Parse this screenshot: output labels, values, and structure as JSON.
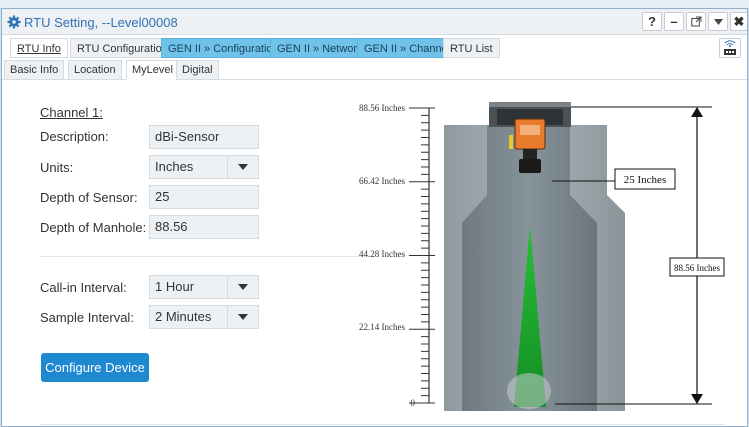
{
  "window": {
    "title": "RTU Setting, --Level00008"
  },
  "titlebar_buttons": {
    "help": "?",
    "minimize": "–",
    "close": "✖"
  },
  "tabs_primary": [
    {
      "label": "RTU Info",
      "active": true
    },
    {
      "label": "RTU Configuration"
    },
    {
      "label": "GEN II » Configuration"
    },
    {
      "label": "GEN II » Network"
    },
    {
      "label": "GEN II » Channel"
    },
    {
      "label": "RTU List"
    }
  ],
  "tabs_secondary": [
    {
      "label": "Basic Info"
    },
    {
      "label": "Location"
    },
    {
      "label": "MyLevel",
      "active": true
    },
    {
      "label": "Digital"
    }
  ],
  "form": {
    "channel_heading": "Channel 1:",
    "description_label": "Description:",
    "description_value": "dBi-Sensor",
    "units_label": "Units:",
    "units_value": "Inches",
    "sensor_depth_label": "Depth of Sensor:",
    "sensor_depth_value": "25",
    "manhole_depth_label": "Depth of Manhole:",
    "manhole_depth_value": "88.56",
    "callin_label": "Call-in Interval:",
    "callin_value": "1 Hour",
    "sample_label": "Sample Interval:",
    "sample_value": "2 Minutes",
    "configure_button": "Configure Device"
  },
  "diagram": {
    "scale_labels": [
      "88.56 Inches",
      "66.42 Inches",
      "44.28 Inches",
      "22.14 Inches",
      "0"
    ],
    "sensor_depth_label": "25 Inches",
    "manhole_depth_label": "88.56 Inches"
  },
  "colors": {
    "accent": "#1e88d0",
    "gen_tab": "#6fc3e9",
    "title_text": "#2f72b5",
    "beam": "#22c232"
  }
}
